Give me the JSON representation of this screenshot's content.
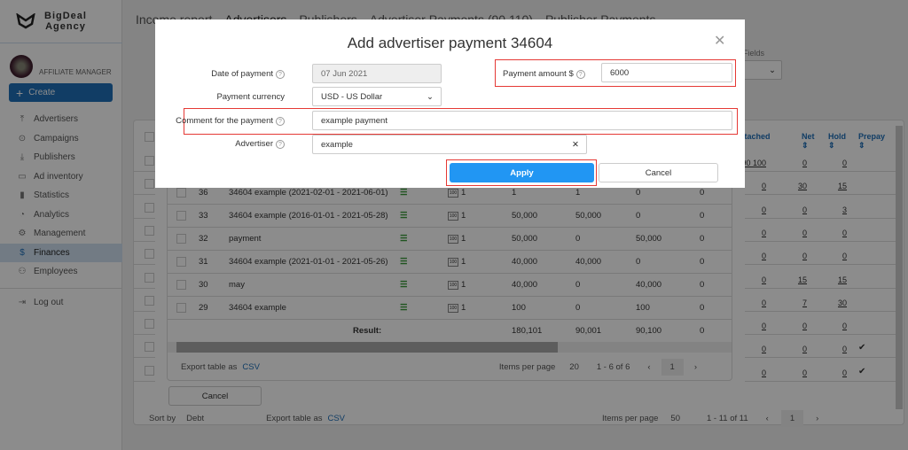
{
  "brand": {
    "line1": "BigDeal",
    "line2": "Agency"
  },
  "user": {
    "role": "AFFILIATE MANAGER"
  },
  "create_label": "Create",
  "nav": [
    {
      "label": "Advertisers",
      "icon": "upload-icon"
    },
    {
      "label": "Campaigns",
      "icon": "play-circle-icon"
    },
    {
      "label": "Publishers",
      "icon": "download-icon"
    },
    {
      "label": "Ad inventory",
      "icon": "inventory-icon"
    },
    {
      "label": "Statistics",
      "icon": "bar-chart-icon"
    },
    {
      "label": "Analytics",
      "icon": "pie-chart-icon"
    },
    {
      "label": "Management",
      "icon": "gear-icon"
    },
    {
      "label": "Finances",
      "icon": "dollar-icon",
      "active": true
    },
    {
      "label": "Employees",
      "icon": "users-icon"
    }
  ],
  "logout": "Log out",
  "tabs": [
    "Income report",
    "Advertisers",
    "Publishers",
    "Advertiser Payments (90,110)",
    "Publisher Payments"
  ],
  "fields_label": "Fields",
  "outer_table": {
    "headers": [
      "Attached",
      "Net",
      "Hold",
      "Prepay"
    ],
    "rows": [
      [
        "90 100",
        "0",
        "0",
        ""
      ],
      [
        "0",
        "30",
        "15",
        ""
      ],
      [
        "0",
        "0",
        "3",
        ""
      ],
      [
        "0",
        "0",
        "0",
        ""
      ],
      [
        "0",
        "0",
        "0",
        ""
      ],
      [
        "0",
        "15",
        "15",
        ""
      ],
      [
        "0",
        "7",
        "30",
        ""
      ],
      [
        "0",
        "0",
        "0",
        ""
      ],
      [
        "0",
        "0",
        "0",
        "✔"
      ],
      [
        "0",
        "0",
        "0",
        "✔"
      ]
    ],
    "sort_label": "Sort by",
    "sort_value": "Debt",
    "export_label": "Export table as",
    "export_link": "CSV",
    "items_label": "Items per page",
    "items_value": "50",
    "range": "1 - 11 of 11",
    "page": "1"
  },
  "inner_table": {
    "rows": [
      [
        "36",
        "34604 example (2021-02-01 - 2021-06-01)",
        "1",
        "1",
        "1",
        "0",
        "0"
      ],
      [
        "33",
        "34604 example (2016-01-01 - 2021-05-28)",
        "1",
        "50,000",
        "50,000",
        "0",
        "0"
      ],
      [
        "32",
        "payment",
        "1",
        "50,000",
        "0",
        "50,000",
        "0"
      ],
      [
        "31",
        "34604 example (2021-01-01 - 2021-05-26)",
        "1",
        "40,000",
        "40,000",
        "0",
        "0"
      ],
      [
        "30",
        "may",
        "1",
        "40,000",
        "0",
        "40,000",
        "0"
      ],
      [
        "29",
        "34604 example",
        "1",
        "100",
        "0",
        "100",
        "0"
      ]
    ],
    "result_label": "Result:",
    "result": [
      "180,101",
      "90,001",
      "90,100",
      "0"
    ],
    "export_label": "Export table as",
    "export_link": "CSV",
    "items_label": "Items per page",
    "items_value": "20",
    "range": "1 - 6 of 6",
    "page": "1",
    "cancel": "Cancel"
  },
  "modal": {
    "title": "Add advertiser payment 34604",
    "date_label": "Date of payment",
    "date_value": "07 Jun 2021",
    "currency_label": "Payment currency",
    "currency_value": "USD - US Dollar",
    "comment_label": "Comment for the payment",
    "comment_value": "example payment",
    "advertiser_label": "Advertiser",
    "advertiser_value": "example",
    "amount_label": "Payment amount $",
    "amount_value": "6000",
    "apply": "Apply",
    "cancel": "Cancel"
  },
  "colors": {
    "accent": "#2196f3",
    "brand": "#1f6fb8",
    "highlight": "#e53935",
    "positive": "#3a9a3a"
  }
}
